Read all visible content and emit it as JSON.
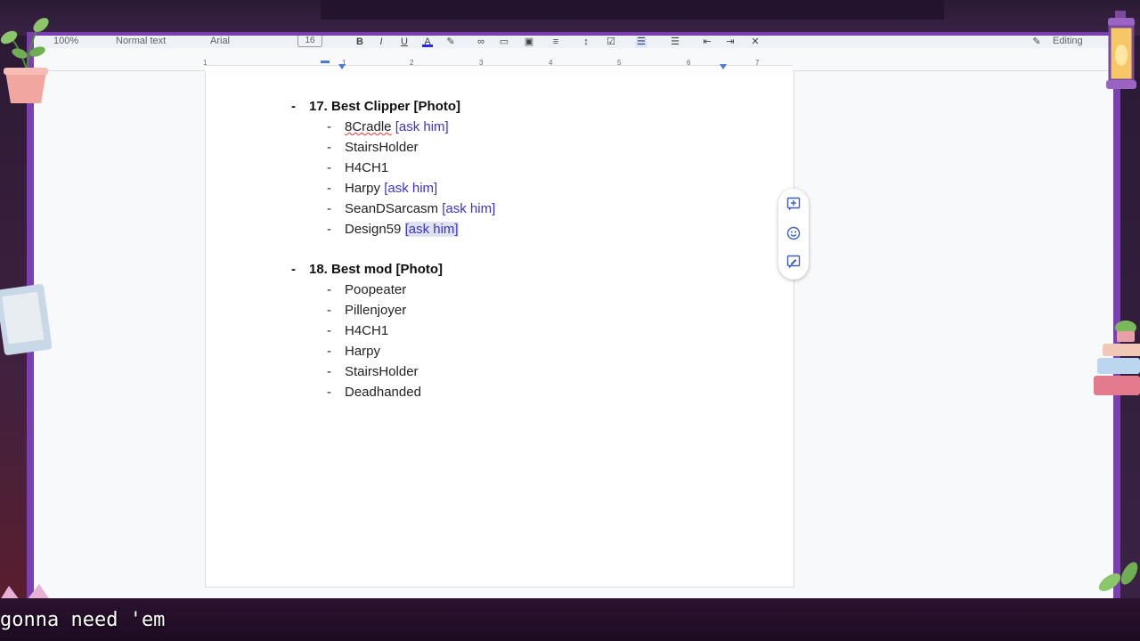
{
  "toolbar": {
    "zoom": "100%",
    "style": "Normal text",
    "font": "Arial",
    "font_size": "16",
    "mode": "Editing"
  },
  "ruler": {
    "ticks": [
      "1",
      "1",
      "2",
      "3",
      "4",
      "5",
      "6",
      "7"
    ]
  },
  "document": {
    "sections": [
      {
        "heading": "17. Best Clipper [Photo]",
        "items": [
          {
            "name": "8Cradle",
            "note": "[ask him]"
          },
          {
            "name": "StairsHolder",
            "note": ""
          },
          {
            "name": "H4CH1",
            "note": ""
          },
          {
            "name": "Harpy",
            "note": "[ask him]"
          },
          {
            "name": "SeanDSarcasm",
            "note": "[ask him]"
          },
          {
            "name": "Design59",
            "note": "[ask him]"
          }
        ]
      },
      {
        "heading": "18. Best mod [Photo]",
        "items": [
          {
            "name": "Poopeater",
            "note": ""
          },
          {
            "name": "Pillenjoyer",
            "note": ""
          },
          {
            "name": "H4CH1",
            "note": ""
          },
          {
            "name": "Harpy",
            "note": ""
          },
          {
            "name": "StairsHolder",
            "note": ""
          },
          {
            "name": "Deadhanded",
            "note": ""
          }
        ]
      }
    ]
  },
  "bullet": "-",
  "side_panel": {
    "icons": [
      "add-comment-icon",
      "emoji-reaction-icon",
      "suggest-edit-icon"
    ]
  },
  "stream": {
    "caption": "gonna need 'em"
  },
  "colors": {
    "link": "#3c33c7",
    "frame_accent": "#7b3fb0"
  }
}
